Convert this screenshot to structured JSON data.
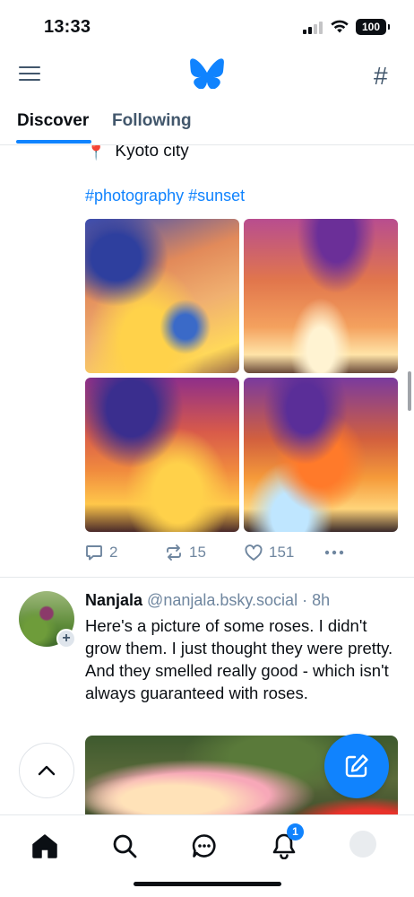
{
  "status_bar": {
    "time": "13:33",
    "battery": "100"
  },
  "header": {
    "logo": "bluesky-butterfly",
    "menu_icon": "menu-icon",
    "feeds_icon": "hash-icon"
  },
  "tabs": [
    {
      "label": "Discover",
      "active": true
    },
    {
      "label": "Following",
      "active": false
    }
  ],
  "post1": {
    "location_icon": "📍",
    "location": "Kyoto city",
    "hashtags": "#photography #sunset",
    "images": [
      "sunset-photo-1",
      "sunset-photo-2",
      "sunset-photo-3",
      "sunset-photo-4"
    ],
    "replies": "2",
    "reposts": "15",
    "likes": "151"
  },
  "post2": {
    "author": "Nanjala",
    "handle": "@nanjala.bsky.social",
    "separator": "·",
    "time": "8h",
    "text": "Here's a picture of some roses. I didn't grow them. I just thought they were pretty. And they smelled really good - which isn't always guaranteed with roses.",
    "image": "roses-photo"
  },
  "bottom_nav": {
    "items": [
      "home-icon",
      "search-icon",
      "chat-icon",
      "notifications-icon",
      "profile-avatar"
    ],
    "notifications_badge": "1"
  },
  "colors": {
    "accent": "#1083fe",
    "text": "#0b0f14",
    "muted": "#6f869f",
    "icon": "#42576c",
    "divider": "#e5e8eb"
  }
}
